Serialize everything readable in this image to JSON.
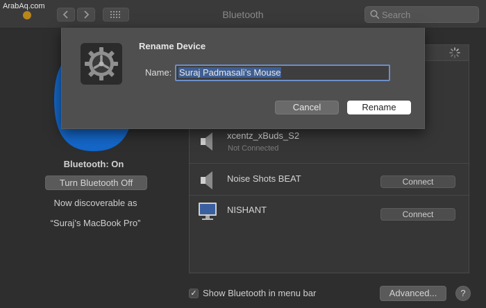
{
  "watermark": "ArabAq.com",
  "window": {
    "title": "Bluetooth"
  },
  "search": {
    "placeholder": "Search"
  },
  "status": {
    "title": "Bluetooth: On",
    "toggle_label": "Turn Bluetooth Off",
    "discoverable_line": "Now discoverable as",
    "computer_name": "“Suraj’s MacBook Pro”"
  },
  "devices": [
    {
      "name": "xcentz_xBuds_S2",
      "status": "Not Connected",
      "icon": "speaker-icon",
      "action": ""
    },
    {
      "name": "Noise Shots BEAT",
      "status": "",
      "icon": "speaker-icon",
      "action": "Connect"
    },
    {
      "name": "NISHANT",
      "status": "",
      "icon": "monitor-icon",
      "action": "Connect"
    }
  ],
  "footer": {
    "menubar_label": "Show Bluetooth in menu bar",
    "menubar_checked": "✓",
    "advanced_label": "Advanced...",
    "help_label": "?"
  },
  "dialog": {
    "title": "Rename Device",
    "name_label": "Name:",
    "name_value": "Suraj Padmasali’s Mouse",
    "cancel_label": "Cancel",
    "rename_label": "Rename"
  },
  "colors": {
    "bluetooth_blue": "#1466c8",
    "selection_blue": "#3f5f93",
    "focus_ring": "#6b8fc8"
  }
}
